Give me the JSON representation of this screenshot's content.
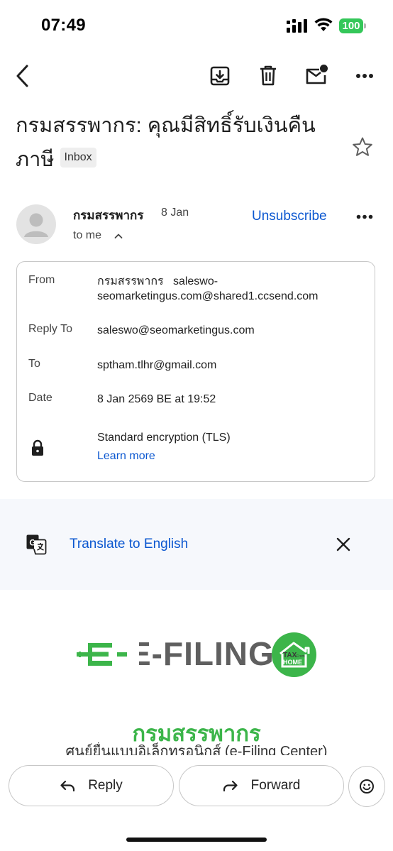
{
  "status_bar": {
    "time": "07:49",
    "battery": "100"
  },
  "toolbar": {
    "back_icon": "chevron-left-icon",
    "archive_icon": "archive-icon",
    "delete_icon": "trash-icon",
    "unread_icon": "mark-unread-icon",
    "more_icon": "more-horizontal-icon"
  },
  "subject": {
    "text": "กรมสรรพากร: คุณมีสิทธิ์รับเงินคืนภาษี",
    "label_chip": "Inbox"
  },
  "sender": {
    "name": "กรมสรรพากร",
    "date": "8 Jan",
    "to": "to me",
    "unsubscribe": "Unsubscribe"
  },
  "details": {
    "from_label": "From",
    "from_name": "กรมสรรพากร",
    "from_email": "saleswo-seomarketingus.com@shared1.ccsend.com",
    "from_email_line1": "saleswo-",
    "from_email_line2": "seomarketingus.com@shared1.ccsend.com",
    "reply_to_label": "Reply To",
    "reply_to": "saleswo@seomarketingus.com",
    "to_label": "To",
    "to": "sptham.tlhr@gmail.com",
    "date_label": "Date",
    "date": "8 Jan 2569 BE at 19:52",
    "encryption": "Standard encryption (TLS)",
    "learn_more": "Learn more"
  },
  "translate": {
    "label": "Translate to English"
  },
  "body": {
    "logo_text": "E-FILING",
    "badge_text_top": "TAX",
    "badge_text_small": "From",
    "badge_text_bottom": "HOME",
    "title": "กรมสรรพากร",
    "subtitle": "ศูนย์ยื่นแบบอิเล็กทรอนิกส์ (e-Filing Center)"
  },
  "actions": {
    "reply": "Reply",
    "forward": "Forward"
  },
  "colors": {
    "link": "#0b57d0",
    "green": "#3cb54a",
    "battery": "#34c759"
  }
}
